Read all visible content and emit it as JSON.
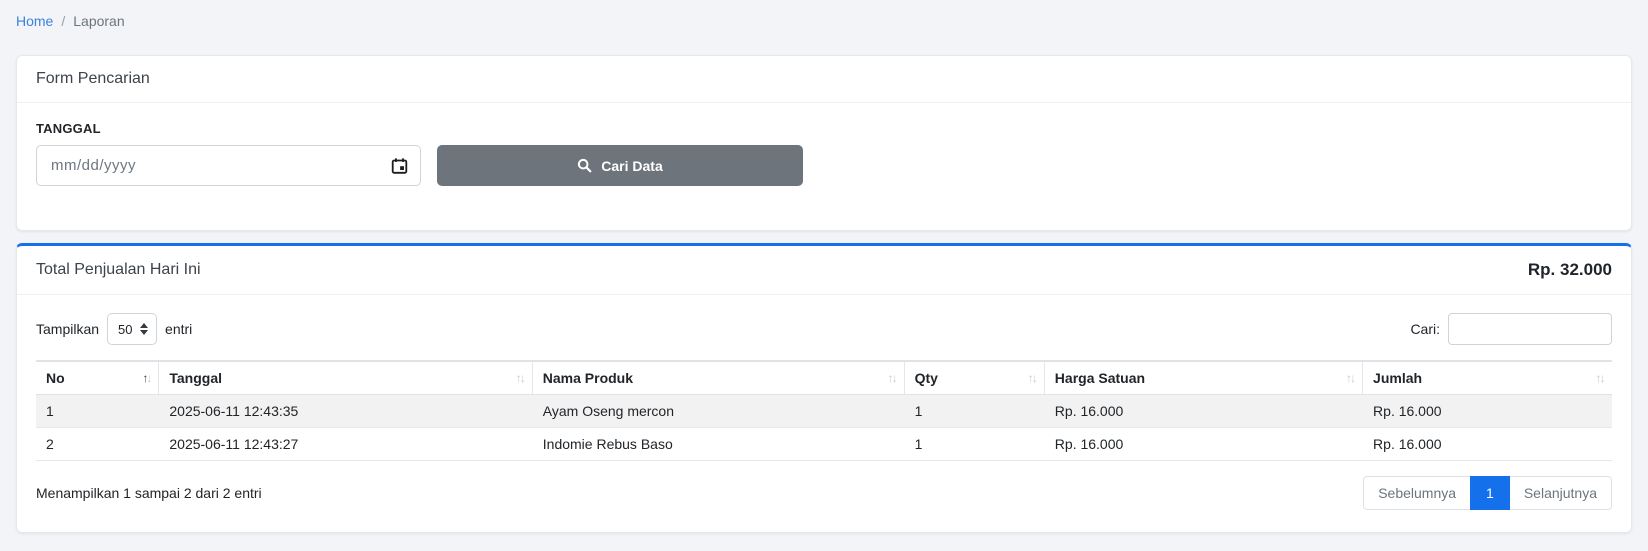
{
  "breadcrumb": {
    "home": "Home",
    "separator": "/",
    "current": "Laporan"
  },
  "search_card": {
    "title": "Form Pencarian",
    "date_label": "TANGGAL",
    "date_placeholder": "mm/dd/yyyy",
    "date_value": "",
    "submit_label": "Cari Data"
  },
  "report_card": {
    "title": "Total Penjualan Hari Ini",
    "total": "Rp. 32.000",
    "length_before": "Tampilkan",
    "length_value": "50",
    "length_after": "entri",
    "search_label": "Cari:",
    "search_value": "",
    "table": {
      "columns": [
        {
          "label": "No",
          "sort": "asc"
        },
        {
          "label": "Tanggal",
          "sort": "none"
        },
        {
          "label": "Nama Produk",
          "sort": "none"
        },
        {
          "label": "Qty",
          "sort": "none"
        },
        {
          "label": "Harga Satuan",
          "sort": "none"
        },
        {
          "label": "Jumlah",
          "sort": "none"
        }
      ],
      "rows": [
        [
          "1",
          "2025-06-11 12:43:35",
          "Ayam Oseng mercon",
          "1",
          "Rp. 16.000",
          "Rp. 16.000"
        ],
        [
          "2",
          "2025-06-11 12:43:27",
          "Indomie Rebus Baso",
          "1",
          "Rp. 16.000",
          "Rp. 16.000"
        ]
      ]
    },
    "info": "Menampilkan 1 sampai 2 dari 2 entri",
    "pagination": {
      "previous": "Sebelumnya",
      "page": "1",
      "next": "Selanjutnya"
    }
  },
  "icons": {
    "calendar": "calendar-icon",
    "search": "search-icon",
    "select_spinner": "select-up-down-icon",
    "sort": "sort-arrows-icon"
  },
  "colors": {
    "accent_blue": "#1471eb",
    "button_gray": "#6d747c",
    "link_blue": "#3b82dd",
    "stripe_gray": "#f2f2f2",
    "page_background": "#f2f4f8"
  }
}
